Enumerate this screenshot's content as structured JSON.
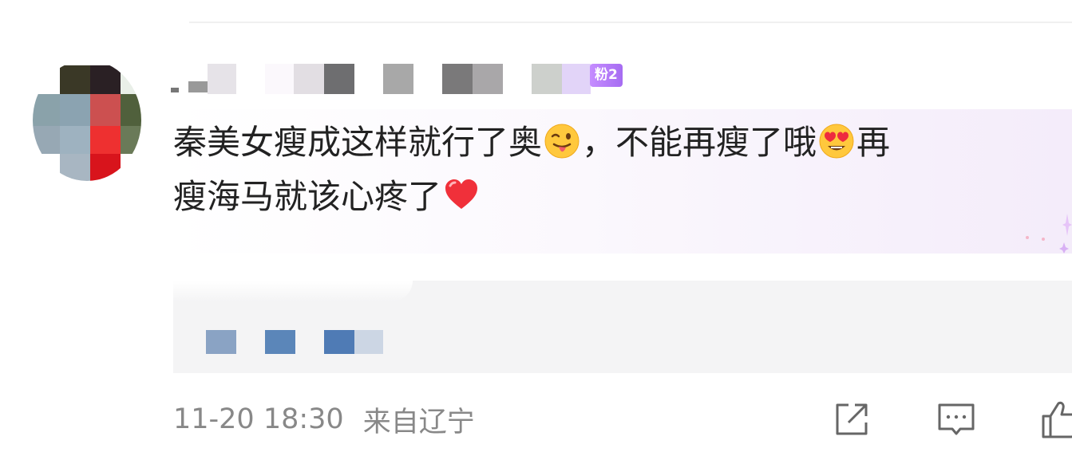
{
  "comment": {
    "user": {
      "name_obscured": true,
      "fan_badge": "粉2"
    },
    "text_line_1_a": "秦美女瘦成这样就行了奥",
    "emoji_1": "tongue-wink-emoji",
    "text_line_1_b": "，不能再瘦了哦",
    "emoji_2": "heart-eyes-emoji",
    "text_line_1_c": "再",
    "text_line_2": "瘦海马就该心疼了",
    "emoji_3": "red-heart-emoji",
    "timestamp": "11-20 18:30",
    "location": "来自辽宁"
  },
  "actions": {
    "share_icon": "share-icon",
    "reply_icon": "comment-icon",
    "like_icon": "thumbs-up-icon"
  },
  "colors": {
    "badge": "#b47cf7",
    "text": "#222222",
    "meta": "#888888",
    "reply_bg": "#f4f4f5",
    "bubble_accent": "#f4ecfa"
  }
}
